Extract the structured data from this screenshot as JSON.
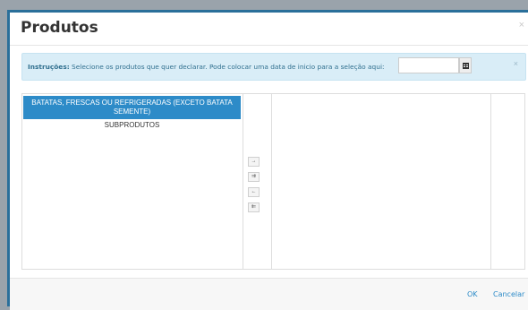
{
  "modal": {
    "title": "Produtos",
    "close_glyph": "×"
  },
  "instructions": {
    "label": "Instruções:",
    "text": " Selecione os produtos que quer declarar. Pode colocar uma data de inicio para a seleção aqui:",
    "date_value": "",
    "date_placeholder": "",
    "calendar_icon": "calendar-icon",
    "close_glyph": "×"
  },
  "available_list": {
    "items": [
      {
        "label": "BATATAS, FRESCAS OU REFRIGERADAS (EXCETO BATATA SEMENTE)",
        "selected": true
      },
      {
        "label": "SUBPRODUTOS",
        "selected": false
      }
    ]
  },
  "selected_list": {
    "items": []
  },
  "move_buttons": [
    {
      "name": "move-selected-right-button",
      "glyph": "→"
    },
    {
      "name": "move-all-right-button",
      "glyph": "⇉"
    },
    {
      "name": "move-selected-left-button",
      "glyph": "←"
    },
    {
      "name": "move-all-left-button",
      "glyph": "⇇"
    }
  ],
  "footer": {
    "ok_label": "OK",
    "cancel_label": "Cancelar"
  },
  "colors": {
    "accent": "#2d8bc8",
    "alert_bg": "#d9edf7",
    "alert_text": "#31708f"
  }
}
